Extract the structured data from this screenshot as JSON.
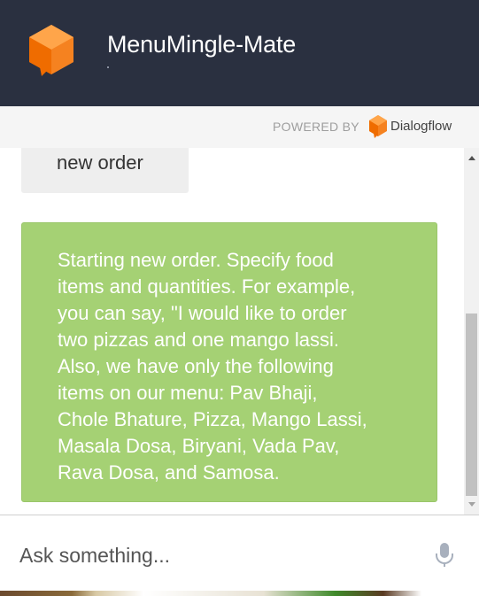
{
  "header": {
    "title": "MenuMingle-Mate",
    "subtitle": "."
  },
  "powered_by": {
    "label": "POWERED BY",
    "brand": "Dialogflow"
  },
  "messages": [
    {
      "from": "user",
      "text": "new order"
    },
    {
      "from": "bot",
      "text": "Starting new order. Specify food\nitems and quantities. For example,\nyou can say, \"I would like to order\ntwo pizzas and one mango lassi.\nAlso, we have only the following\nitems on our menu: Pav Bhaji,\nChole Bhature, Pizza, Mango Lassi,\nMasala Dosa, Biryani, Vada Pav,\nRava Dosa, and Samosa."
    }
  ],
  "input": {
    "placeholder": "Ask something...",
    "value": ""
  },
  "icons": {
    "agent_logo": "dialogflow-agent-icon",
    "brand_logo": "dialogflow-logo-icon",
    "mic": "microphone-icon"
  },
  "colors": {
    "header_bg": "#2a3040",
    "accent_orange": "#f58220",
    "bot_bubble": "#a5d174",
    "user_bubble": "#eeeeee"
  }
}
